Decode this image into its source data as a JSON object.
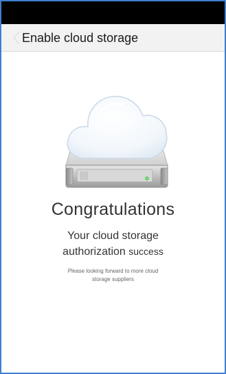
{
  "header": {
    "title": "Enable cloud storage",
    "back_icon": "chevron-left-icon"
  },
  "illustration": {
    "icon": "cloud-hard-drive-icon"
  },
  "main": {
    "heading": "Congratulations",
    "subtitle_line1": "Your cloud storage",
    "subtitle_line2_a": "authorization",
    "subtitle_line2_b": "success",
    "note_line1": "Please looking forward to more cloud",
    "note_line2": "storage suppliers"
  },
  "colors": {
    "frame_border": "#3f7fd0",
    "status_bar": "#000000",
    "header_bg": "#f2f2f2",
    "drive_led": "#3cc43c"
  }
}
